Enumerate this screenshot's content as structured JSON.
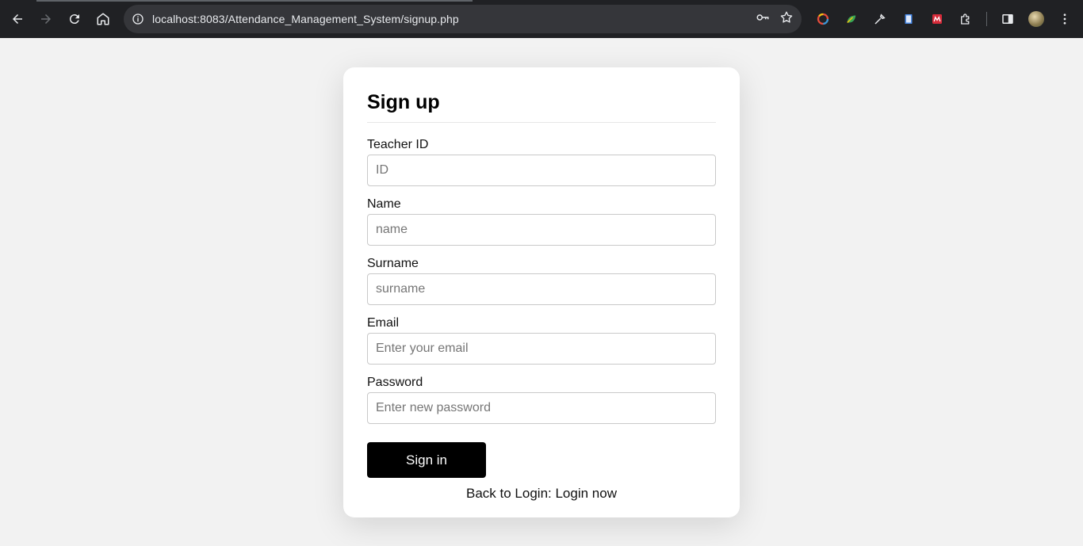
{
  "browser": {
    "url": "localhost:8083/Attendance_Management_System/signup.php",
    "icons": {
      "back": "arrow-left-icon",
      "forward": "arrow-right-icon",
      "reload": "reload-icon",
      "home": "home-icon",
      "site_info": "info-icon",
      "password": "key-icon",
      "bookmark": "star-icon",
      "extensions": [
        "color-wheel-icon",
        "leaf-icon",
        "eyedropper-icon",
        "book-icon",
        "mendeley-icon",
        "puzzle-icon"
      ],
      "side_panel": "side-panel-icon",
      "menu": "more-vertical-icon"
    }
  },
  "form": {
    "title": "Sign up",
    "fields": [
      {
        "label": "Teacher ID",
        "placeholder": "ID",
        "value": ""
      },
      {
        "label": "Name",
        "placeholder": "name",
        "value": ""
      },
      {
        "label": "Surname",
        "placeholder": "surname",
        "value": ""
      },
      {
        "label": "Email",
        "placeholder": "Enter your email",
        "value": ""
      },
      {
        "label": "Password",
        "placeholder": "Enter new password",
        "value": ""
      }
    ],
    "submit_label": "Sign in",
    "back_text": "Back to Login: Login now"
  },
  "colors": {
    "browser_bg": "#202124",
    "omnibox_bg": "#35363a",
    "page_bg": "#f2f2f2",
    "card_bg": "#ffffff",
    "button_bg": "#000000",
    "button_text": "#ffffff"
  }
}
